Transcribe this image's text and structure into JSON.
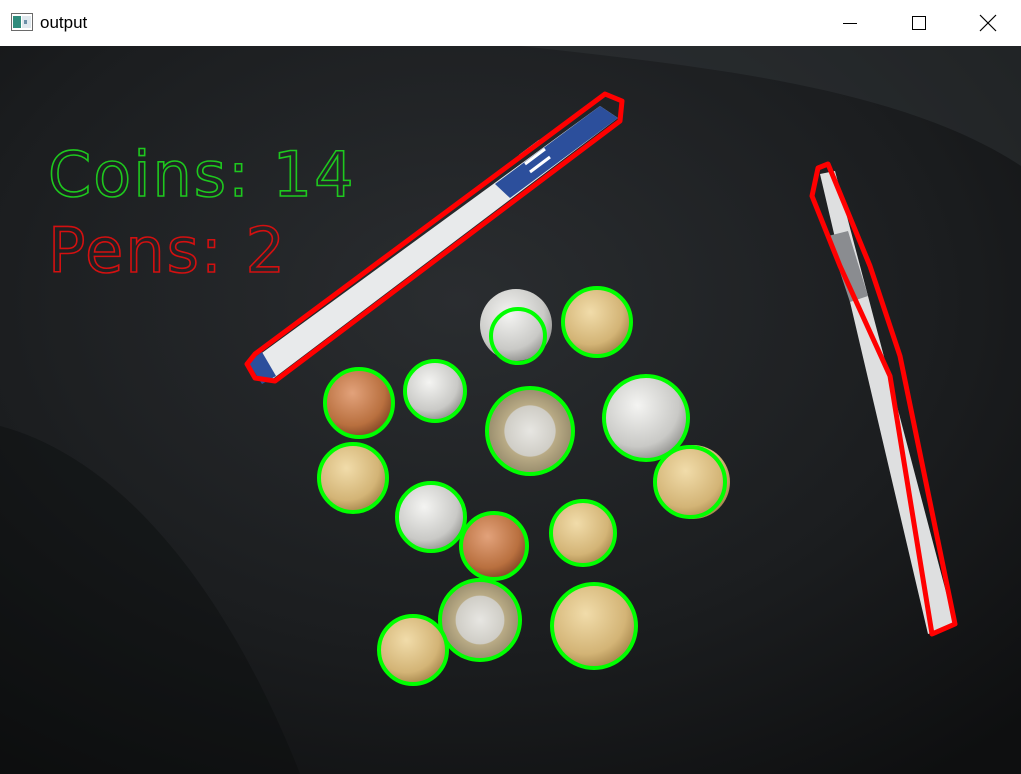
{
  "window": {
    "title": "output",
    "icon": "opencv-window-icon",
    "controls": [
      "minimize-icon",
      "maximize-icon",
      "close-icon"
    ]
  },
  "overlay": {
    "coins_text": "Coins: 14",
    "pens_text": "Pens: 2",
    "coins_color": "#1ec81e",
    "pens_color": "#d41010"
  },
  "colors": {
    "coin_outline": "#00ff00",
    "pen_outline": "#ff0000",
    "background": "#161819"
  }
}
